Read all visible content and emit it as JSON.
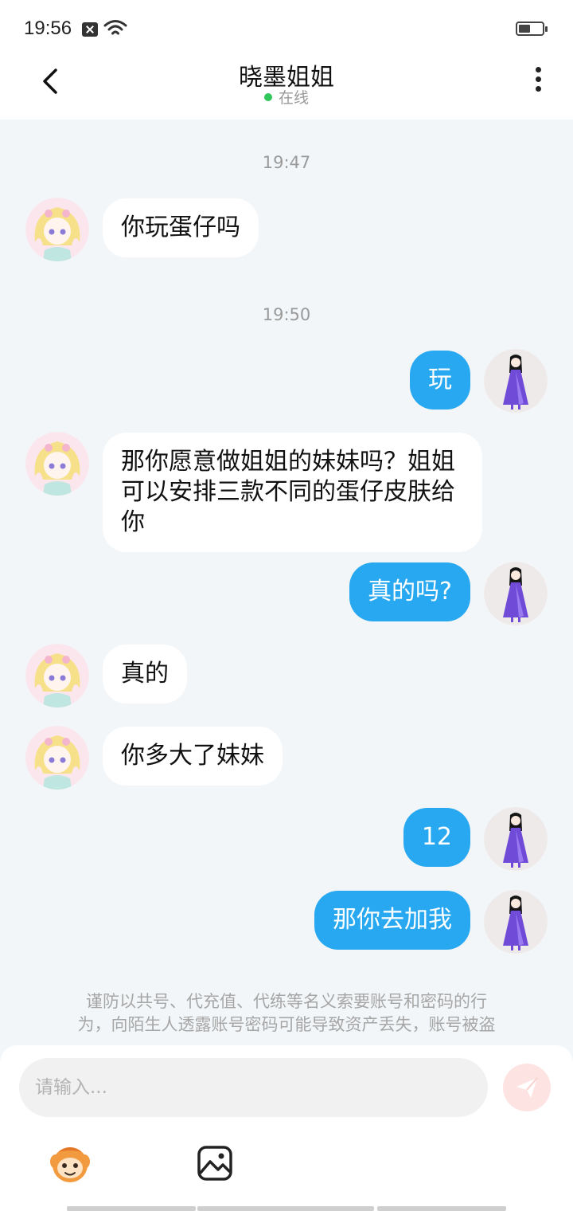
{
  "status_bar": {
    "time": "19:56"
  },
  "header": {
    "title": "晓墨姐姐",
    "status": "在线",
    "status_color": "#2fc75a"
  },
  "messages": [
    {
      "type": "time",
      "text": "19:47"
    },
    {
      "type": "in",
      "text": "你玩蛋仔吗"
    },
    {
      "type": "time",
      "text": "19:50"
    },
    {
      "type": "out",
      "text": "玩"
    },
    {
      "type": "in",
      "line1": "那你愿意做姐姐的妹妹吗？姐姐",
      "line2": "可以安排三款不同的蛋仔皮肤给",
      "line3": "你"
    },
    {
      "type": "out",
      "text": "真的吗?"
    },
    {
      "type": "in",
      "text": "真的"
    },
    {
      "type": "in",
      "text": "你多大了妹妹"
    },
    {
      "type": "out",
      "text": "12"
    },
    {
      "type": "out",
      "text": "那你去加我"
    }
  ],
  "notice": {
    "line1": "谨防以共号、代充值、代练等名义索要账号和密码的行",
    "line2": "为，向陌生人透露账号密码可能导致资产丢失，账号被盗"
  },
  "composer": {
    "placeholder": "请输入..."
  },
  "colors": {
    "accent": "#27a8f0",
    "background": "#f3f6f8",
    "send_button": "#fde4e2"
  },
  "icons": {
    "back": "chevron-left-icon",
    "more": "more-vertical-icon",
    "send": "paper-plane-icon",
    "emoji": "emoji-mascot-icon",
    "image": "image-icon"
  }
}
